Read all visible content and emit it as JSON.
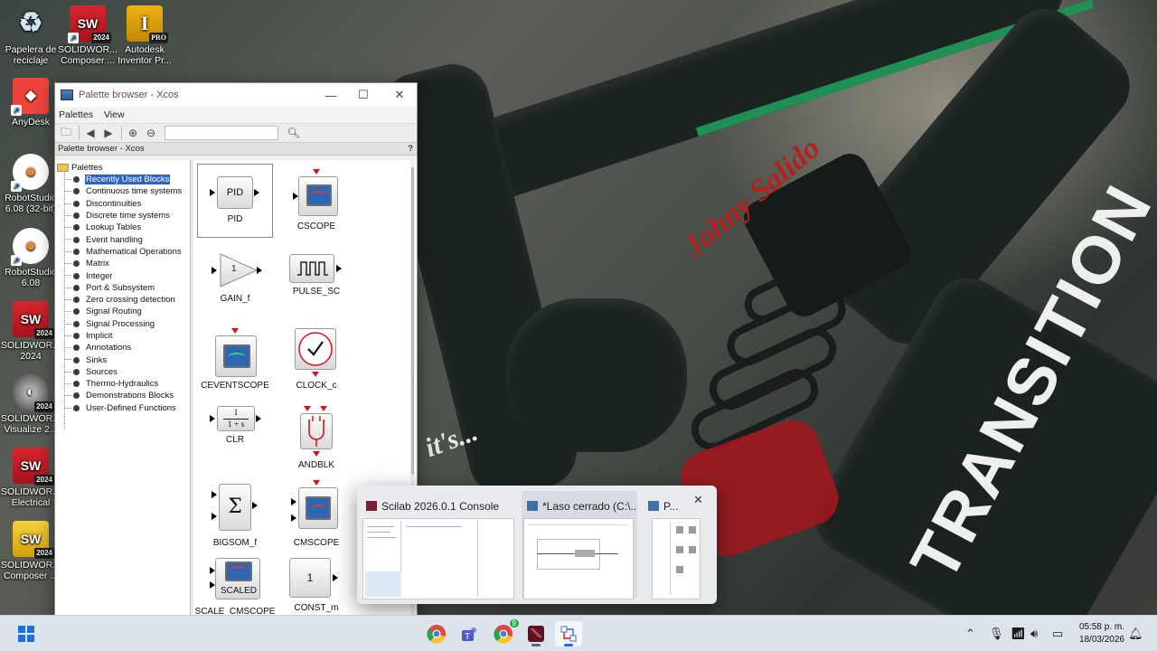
{
  "desktop": {
    "icons": [
      {
        "label": "Papelera de reciclaje",
        "icon": "recycle-bin-icon"
      },
      {
        "label": "SOLIDWOR... Composer ...",
        "icon": "solidworks-composer-icon"
      },
      {
        "label": "Autodesk Inventor Pr...",
        "icon": "autodesk-inventor-icon",
        "badge": "PRO"
      },
      {
        "label": "AnyDesk",
        "icon": "anydesk-icon"
      },
      {
        "label": "RobotStudio 6.08 (32-bit)",
        "icon": "robotstudio-icon"
      },
      {
        "label": "RobotStudio 6.08",
        "icon": "robotstudio-icon"
      },
      {
        "label": "SOLIDWOR... 2024",
        "icon": "solidworks-icon"
      },
      {
        "label": "SOLIDWOR... Visualize 2...",
        "icon": "solidworks-visualize-icon"
      },
      {
        "label": "SOLIDWOR... Electrical",
        "icon": "solidworks-electrical-icon"
      },
      {
        "label": "SOLIDWOR... Composer ...",
        "icon": "solidworks-composer-icon"
      }
    ],
    "badge_year": "2024"
  },
  "wallpaper": {
    "text1": "Johny Salido",
    "text2": "TRANSITION",
    "text3": "it's..."
  },
  "palette_window": {
    "title": "Palette browser - Xcos",
    "menu": [
      "Palettes",
      "View"
    ],
    "search_value": "",
    "header": "Palette browser - Xcos",
    "help": "?",
    "tree_root": "Palettes",
    "tree_items": [
      "Recently Used Blocks",
      "Continuous time systems",
      "Discontinuities",
      "Discrete time systems",
      "Lookup Tables",
      "Event handling",
      "Mathematical Operations",
      "Matrix",
      "Integer",
      "Port & Subsystem",
      "Zero crossing detection",
      "Signal Routing",
      "Signal Processing",
      "Implicit",
      "Annotations",
      "Sinks",
      "Sources",
      "Thermo-Hydraulics",
      "Demonstrations Blocks",
      "User-Defined Functions"
    ],
    "selected_index": 0,
    "blocks": {
      "pid": {
        "label": "PID",
        "text": "PID"
      },
      "cscope": {
        "label": "CSCOPE"
      },
      "gain_f": {
        "label": "GAIN_f",
        "text": "1"
      },
      "pulse_sc": {
        "label": "PULSE_SC"
      },
      "ceventscope": {
        "label": "CEVENTSCOPE"
      },
      "clock_c": {
        "label": "CLOCK_c"
      },
      "clr": {
        "label": "CLR",
        "num": "1",
        "den": "1 + s"
      },
      "andblk": {
        "label": "ANDBLK"
      },
      "bigsom_f": {
        "label": "BIGSOM_f",
        "text": "Σ"
      },
      "cmscope": {
        "label": "CMSCOPE"
      },
      "scale_cmscope": {
        "label": "SCALE_CMSCOPE",
        "text": "SCALED"
      },
      "const_m": {
        "label": "CONST_m",
        "text": "1"
      }
    }
  },
  "thumbnail_popup": {
    "items": [
      {
        "title": "Scilab 2026.0.1 Console"
      },
      {
        "title": "*Laso cerrado (C:\\..."
      },
      {
        "title": "P..."
      }
    ]
  },
  "taskbar": {
    "time": "05:58 p. m.",
    "date": "18/03/2026",
    "chrome_badge": "9"
  },
  "colors": {
    "selection": "#2f64c0",
    "event_port": "#d8131b",
    "scope_screen": "#2d66b3",
    "taskbar": "#dde3ea"
  }
}
